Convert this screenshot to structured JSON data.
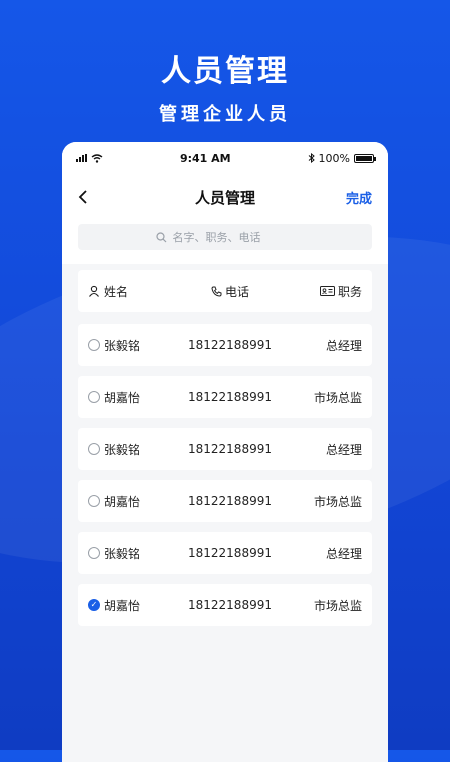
{
  "hero": {
    "title": "人员管理",
    "subtitle": "管理企业人员"
  },
  "status_bar": {
    "time": "9:41 AM",
    "battery": "100%"
  },
  "nav": {
    "back_icon": "chevron-left-icon",
    "title": "人员管理",
    "done_label": "完成"
  },
  "search": {
    "placeholder": "名字、职务、电话"
  },
  "table": {
    "headers": {
      "name": "姓名",
      "phone": "电话",
      "title": "职务"
    },
    "rows": [
      {
        "name": "张毅铭",
        "phone": "18122188991",
        "title": "总经理",
        "selected": false
      },
      {
        "name": "胡嘉怡",
        "phone": "18122188991",
        "title": "市场总监",
        "selected": false
      },
      {
        "name": "张毅铭",
        "phone": "18122188991",
        "title": "总经理",
        "selected": false
      },
      {
        "name": "胡嘉怡",
        "phone": "18122188991",
        "title": "市场总监",
        "selected": false
      },
      {
        "name": "张毅铭",
        "phone": "18122188991",
        "title": "总经理",
        "selected": false
      },
      {
        "name": "胡嘉怡",
        "phone": "18122188991",
        "title": "市场总监",
        "selected": true
      }
    ]
  },
  "colors": {
    "accent": "#1a5fe6",
    "background": "#1557e8"
  }
}
